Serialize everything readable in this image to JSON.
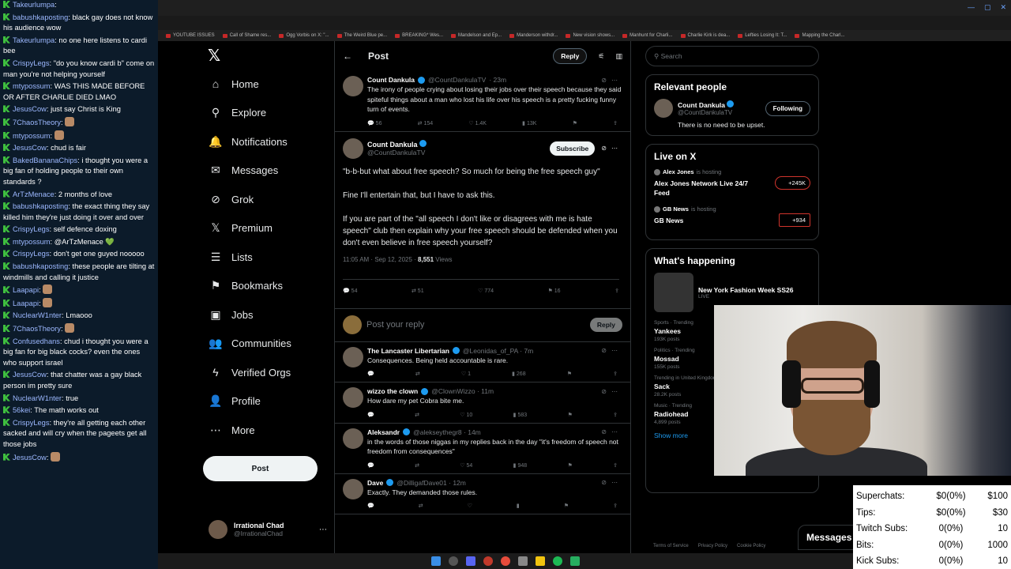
{
  "chat": [
    {
      "user": "Takeurlumpa",
      "msg": ""
    },
    {
      "user": "babushkaposting",
      "msg": "black gay does not know his audience wow"
    },
    {
      "user": "Takeurlumpa",
      "msg": "no one here listens to cardi bee"
    },
    {
      "user": "CrispyLegs",
      "msg": "\"do you know cardi b\" come on man you're not helping yourself"
    },
    {
      "user": "mtypossum",
      "msg": "WAS THIS MADE BEFORE OR AFTER CHARLIE DIED LMAO"
    },
    {
      "user": "JesusCow",
      "msg": "just say Christ is King"
    },
    {
      "user": "7ChaosTheory",
      "msg": "",
      "emote": true
    },
    {
      "user": "mtypossum",
      "msg": "",
      "emote": true
    },
    {
      "user": "JesusCow",
      "msg": "chud is fair"
    },
    {
      "user": "BakedBananaChips",
      "msg": "i thought you were a big fan of holding people to their own standards ?"
    },
    {
      "user": "ArTzMenace",
      "msg": "2 months of love"
    },
    {
      "user": "babushkaposting",
      "msg": "the exact thing they say killed him they're just doing it over and over"
    },
    {
      "user": "CrispyLegs",
      "msg": "self defence doxing"
    },
    {
      "user": "mtypossum",
      "msg": "@ArTzMenace 💚"
    },
    {
      "user": "CrispyLegs",
      "msg": "don't get one guyed nooooo"
    },
    {
      "user": "babushkaposting",
      "msg": "these people are tilting at windmills and calling it justice"
    },
    {
      "user": "Laapapi",
      "msg": "",
      "emote": true
    },
    {
      "user": "Laapapi",
      "msg": "",
      "emote": true
    },
    {
      "user": "NuclearW1nter",
      "msg": "Lmaooo"
    },
    {
      "user": "7ChaosTheory",
      "msg": "",
      "emote": true
    },
    {
      "user": "Confusedhans",
      "msg": "chud i thought you were a big fan for big black cocks? even the ones who support israel"
    },
    {
      "user": "JesusCow",
      "msg": "that chatter was a gay black person im pretty sure"
    },
    {
      "user": "NuclearW1nter",
      "msg": "true"
    },
    {
      "user": "56kei",
      "msg": "The math works out"
    },
    {
      "user": "CrispyLegs",
      "msg": "they're all getting each other sacked and will cry when the pageets get all those jobs"
    },
    {
      "user": "JesusCow",
      "msg": "",
      "emote": true
    }
  ],
  "browser": {
    "bookmarks": [
      "YOUTUBE ISSUES",
      "Call of Shame res...",
      "Ogg Vorbis on X: \"...",
      "The Weird Blue pe...",
      "BREAKING* Wes...",
      "Mandelson and Ep...",
      "Manderson withdr...",
      "New vision shows...",
      "Manhunt for Charli...",
      "Charlie Kirk is dea...",
      "Lefties Losing It: T...",
      "Mapping the Charl..."
    ]
  },
  "nav": {
    "items": [
      {
        "label": "Home",
        "icon": "⌂",
        "name": "home"
      },
      {
        "label": "Explore",
        "icon": "⚲",
        "name": "explore"
      },
      {
        "label": "Notifications",
        "icon": "🔔",
        "name": "notifications"
      },
      {
        "label": "Messages",
        "icon": "✉",
        "name": "messages"
      },
      {
        "label": "Grok",
        "icon": "⊘",
        "name": "grok"
      },
      {
        "label": "Premium",
        "icon": "𝕏",
        "name": "premium"
      },
      {
        "label": "Lists",
        "icon": "☰",
        "name": "lists"
      },
      {
        "label": "Bookmarks",
        "icon": "⚑",
        "name": "bookmarks"
      },
      {
        "label": "Jobs",
        "icon": "▣",
        "name": "jobs"
      },
      {
        "label": "Communities",
        "icon": "👥",
        "name": "communities"
      },
      {
        "label": "Verified Orgs",
        "icon": "ϟ",
        "name": "verified-orgs"
      },
      {
        "label": "Profile",
        "icon": "👤",
        "name": "profile"
      },
      {
        "label": "More",
        "icon": "⋯",
        "name": "more"
      }
    ],
    "post_label": "Post",
    "me_name": "Irrational Chad",
    "me_handle": "@IrrationalChad"
  },
  "header": {
    "title": "Post",
    "reply_label": "Reply"
  },
  "tweets_top": [
    {
      "name": "Count Dankula",
      "handle": "@CountDankulaTV",
      "time": "· 23m",
      "text": "The irony of people crying about losing their jobs over their speech because they said spiteful things about a man who lost his life over his speech is a pretty fucking funny turn of events.",
      "replies": "56",
      "retweets": "154",
      "likes": "1.4K",
      "views": "13K"
    }
  ],
  "focus": {
    "name": "Count Dankula",
    "handle": "@CountDankulaTV",
    "subscribe": "Subscribe",
    "p1": "\"b-b-but what about free speech? So much for being the free speech guy\"",
    "p2": "Fine I'll entertain that, but I have to ask this.",
    "p3": "If you are part of the \"all speech I don't like or disagrees with me is hate speech\" club then explain why your free speech should be defended when you don't even believe in free speech yourself?",
    "time": "11:05 AM · Sep 12, 2025 · ",
    "views": "8,551",
    "views_label": " Views",
    "replies": "54",
    "retweets": "51",
    "likes": "774",
    "bookmarks": "16"
  },
  "reply_box": {
    "placeholder": "Post your reply",
    "button": "Reply"
  },
  "replies": [
    {
      "name": "The Lancaster Libertarian",
      "handle": "@Leonidas_of_PA · 7m",
      "text": "Consequences. Being held accountable is rare.",
      "replies": "",
      "retweets": "",
      "likes": "1",
      "views": "268"
    },
    {
      "name": "wizzo the clown",
      "handle": "@ClownWizzo · 11m",
      "text": "How dare my pet Cobra bite me.",
      "replies": "",
      "retweets": "",
      "likes": "10",
      "views": "583"
    },
    {
      "name": "Aleksandr",
      "handle": "@alekseythegr8 · 14m",
      "text": "in the words of those niggas in my replies back in the day \"it's freedom of speech not freedom from consequences\"",
      "replies": "",
      "retweets": "",
      "likes": "54",
      "views": "948"
    },
    {
      "name": "Dave",
      "handle": "@DilligafDave01 · 12m",
      "text": "Exactly. They demanded those rules.",
      "replies": "",
      "retweets": "",
      "likes": "",
      "views": ""
    }
  ],
  "right": {
    "search_placeholder": "Search",
    "relevant_title": "Relevant people",
    "rp_name": "Count Dankula",
    "rp_handle": "@CountDankulaTV",
    "rp_follow": "Following",
    "rp_bio": "There is no need to be upset.",
    "live_title": "Live on X",
    "live": [
      {
        "host": "Alex Jones",
        "suffix": "is hosting",
        "title": "Alex Jones Network Live 24/7 Feed",
        "count": "+245K"
      },
      {
        "host": "GB News",
        "suffix": "is hosting",
        "title": "GB News",
        "count": "+934"
      }
    ],
    "happening_title": "What's happening",
    "happening_event": "New York Fashion Week SS26",
    "happening_live": "LIVE",
    "trends": [
      {
        "cat": "Sports · Trending",
        "t": "Yankees",
        "c": "193K posts"
      },
      {
        "cat": "Politics · Trending",
        "t": "Mossad",
        "c": "155K posts"
      },
      {
        "cat": "Trending in United Kingdom",
        "t": "Sack",
        "c": "28.2K posts"
      },
      {
        "cat": "Music · Trending",
        "t": "Radiohead",
        "c": "4,899 posts"
      }
    ],
    "show_more": "Show more",
    "footer": [
      "Terms of Service",
      "Privacy Policy",
      "Cookie Policy"
    ]
  },
  "messages_tab": "Messages",
  "stats": [
    {
      "l": "Superchats:",
      "m": "$0(0%)",
      "r": "$100"
    },
    {
      "l": "Tips:",
      "m": "$0(0%)",
      "r": "$30"
    },
    {
      "l": "Twitch Subs:",
      "m": "0(0%)",
      "r": "10"
    },
    {
      "l": "Bits:",
      "m": "0(0%)",
      "r": "1000"
    },
    {
      "l": "Kick Subs:",
      "m": "0(0%)",
      "r": "10"
    }
  ]
}
